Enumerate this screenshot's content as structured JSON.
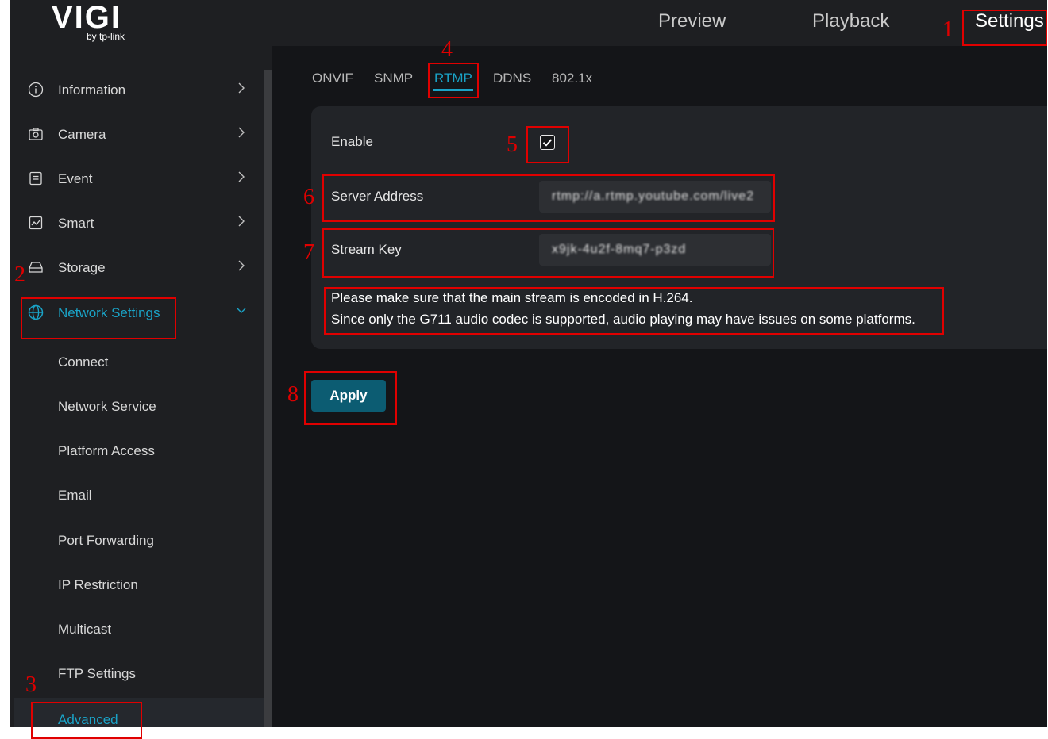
{
  "brand": {
    "logo_text": "VIGI",
    "logo_subtext": "by tp-link"
  },
  "topnav": [
    {
      "label": "Preview"
    },
    {
      "label": "Playback"
    },
    {
      "label": "Settings",
      "active": true
    }
  ],
  "sidebar": {
    "items": [
      {
        "label": "Information",
        "icon": "info-icon"
      },
      {
        "label": "Camera",
        "icon": "camera-icon"
      },
      {
        "label": "Event",
        "icon": "event-icon"
      },
      {
        "label": "Smart",
        "icon": "smart-icon"
      },
      {
        "label": "Storage",
        "icon": "storage-icon"
      },
      {
        "label": "Network Settings",
        "icon": "globe-icon",
        "active": true,
        "expanded": true
      }
    ],
    "subitems": [
      {
        "label": "Connect"
      },
      {
        "label": "Network Service"
      },
      {
        "label": "Platform Access"
      },
      {
        "label": "Email"
      },
      {
        "label": "Port Forwarding"
      },
      {
        "label": "IP Restriction"
      },
      {
        "label": "Multicast"
      },
      {
        "label": "FTP Settings"
      },
      {
        "label": "Advanced",
        "active": true
      }
    ]
  },
  "tabs": [
    {
      "label": "ONVIF"
    },
    {
      "label": "SNMP"
    },
    {
      "label": "RTMP",
      "active": true
    },
    {
      "label": "DDNS"
    },
    {
      "label": "802.1x"
    }
  ],
  "form": {
    "enable_label": "Enable",
    "enable_checked": true,
    "server_address_label": "Server Address",
    "server_address_value": "rtmp://a.rtmp.youtube.com/live2",
    "stream_key_label": "Stream Key",
    "stream_key_value": "x9jk-4u2f-8mq7-p3zd",
    "note_line1": "Please make sure that the main stream is encoded in H.264.",
    "note_line2": "Since only the G711 audio codec is supported, audio playing may have issues on some platforms.",
    "apply_label": "Apply"
  },
  "annotations": {
    "n1": "1",
    "n2": "2",
    "n3": "3",
    "n4": "4",
    "n5": "5",
    "n6": "6",
    "n7": "7",
    "n8": "8"
  },
  "colors": {
    "accent": "#1aa3c7",
    "apply_button": "#0c5c72",
    "annotation": "#e00000",
    "background": "#1e1f22",
    "main_background": "#141518"
  }
}
